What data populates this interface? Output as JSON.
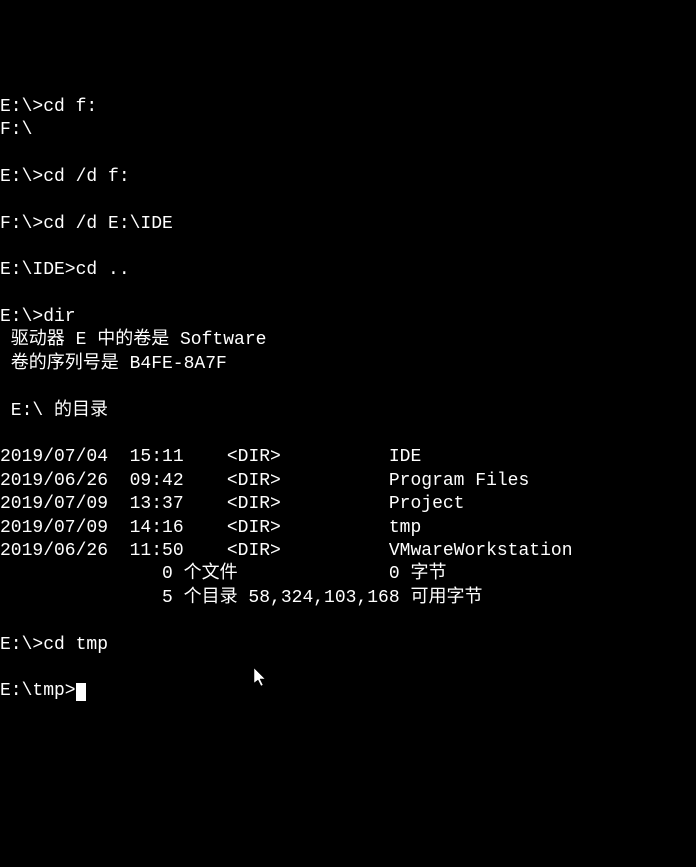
{
  "lines": {
    "l0": "E:\\>cd f:",
    "l1": "F:\\",
    "l2": "",
    "l3": "E:\\>cd /d f:",
    "l4": "",
    "l5": "F:\\>cd /d E:\\IDE",
    "l6": "",
    "l7": "E:\\IDE>cd ..",
    "l8": "",
    "l9": "E:\\>dir",
    "l10": " 驱动器 E 中的卷是 Software",
    "l11": " 卷的序列号是 B4FE-8A7F",
    "l12": "",
    "l13": " E:\\ 的目录",
    "l14": "",
    "l15": "2019/07/04  15:11    <DIR>          IDE",
    "l16": "2019/06/26  09:42    <DIR>          Program Files",
    "l17": "2019/07/09  13:37    <DIR>          Project",
    "l18": "2019/07/09  14:16    <DIR>          tmp",
    "l19": "2019/06/26  11:50    <DIR>          VMwareWorkstation",
    "l20": "               0 个文件              0 字节",
    "l21": "               5 个目录 58,324,103,168 可用字节",
    "l22": "",
    "l23": "E:\\>cd tmp",
    "l24": "",
    "l25": "E:\\tmp>"
  },
  "dir_listing": {
    "volume_label": "Software",
    "serial": "B4FE-8A7F",
    "path": "E:\\",
    "entries": [
      {
        "date": "2019/07/04",
        "time": "15:11",
        "type": "<DIR>",
        "name": "IDE"
      },
      {
        "date": "2019/06/26",
        "time": "09:42",
        "type": "<DIR>",
        "name": "Program Files"
      },
      {
        "date": "2019/07/09",
        "time": "13:37",
        "type": "<DIR>",
        "name": "Project"
      },
      {
        "date": "2019/07/09",
        "time": "14:16",
        "type": "<DIR>",
        "name": "tmp"
      },
      {
        "date": "2019/06/26",
        "time": "11:50",
        "type": "<DIR>",
        "name": "VMwareWorkstation"
      }
    ],
    "file_count": 0,
    "file_bytes": 0,
    "dir_count": 5,
    "free_bytes": "58,324,103,168"
  }
}
